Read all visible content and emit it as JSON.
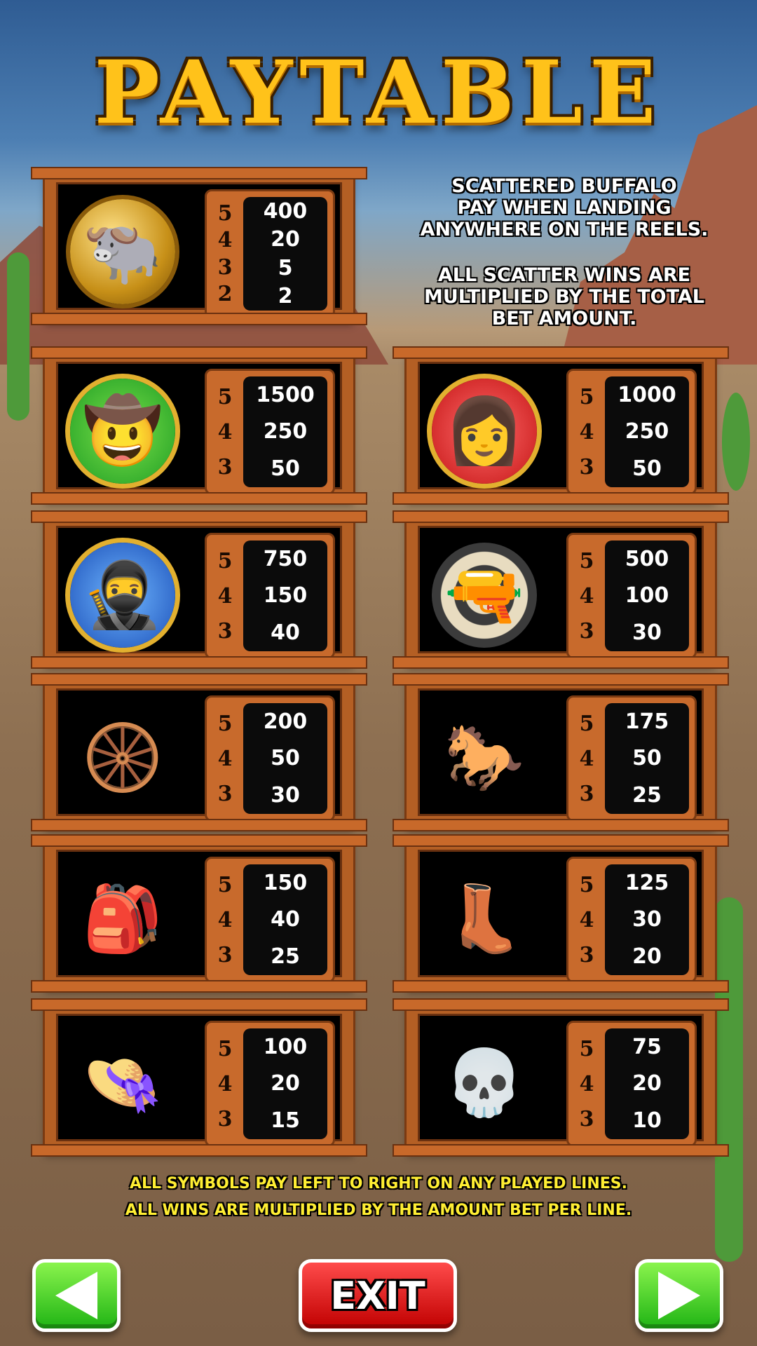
{
  "title": "PAYTABLE",
  "scatter_info": {
    "lines": [
      "SCATTERED BUFFALO",
      "PAY WHEN LANDING",
      "ANYWHERE ON THE REELS.",
      "",
      "ALL SCATTER WINS ARE",
      "MULTIPLIED BY THE TOTAL",
      "BET AMOUNT."
    ]
  },
  "symbols": [
    {
      "name": "buffalo",
      "icon": "buffalo-coin-icon",
      "glyph": "🐃",
      "counts": [
        "5",
        "4",
        "3",
        "2"
      ],
      "values": [
        "400",
        "20",
        "5",
        "2"
      ]
    },
    {
      "name": "cowboy",
      "icon": "cowboy-portrait-icon",
      "glyph": "🤠",
      "counts": [
        "5",
        "4",
        "3"
      ],
      "values": [
        "1500",
        "250",
        "50"
      ]
    },
    {
      "name": "cowgirl",
      "icon": "cowgirl-portrait-icon",
      "glyph": "👩",
      "counts": [
        "5",
        "4",
        "3"
      ],
      "values": [
        "1000",
        "250",
        "50"
      ]
    },
    {
      "name": "bandit",
      "icon": "bandit-portrait-icon",
      "glyph": "🥷",
      "counts": [
        "5",
        "4",
        "3"
      ],
      "values": [
        "750",
        "150",
        "40"
      ]
    },
    {
      "name": "revolver",
      "icon": "revolver-target-icon",
      "glyph": "🔫",
      "counts": [
        "5",
        "4",
        "3"
      ],
      "values": [
        "500",
        "100",
        "30"
      ]
    },
    {
      "name": "wagon",
      "icon": "covered-wagon-icon",
      "glyph": "🛞",
      "counts": [
        "5",
        "4",
        "3"
      ],
      "values": [
        "200",
        "50",
        "30"
      ]
    },
    {
      "name": "saddle",
      "icon": "saddle-icon",
      "glyph": "🐎",
      "counts": [
        "5",
        "4",
        "3"
      ],
      "values": [
        "175",
        "50",
        "25"
      ]
    },
    {
      "name": "gunbelt",
      "icon": "gun-belt-icon",
      "glyph": "🎒",
      "counts": [
        "5",
        "4",
        "3"
      ],
      "values": [
        "150",
        "40",
        "25"
      ]
    },
    {
      "name": "boots",
      "icon": "cowboy-boots-icon",
      "glyph": "👢",
      "counts": [
        "5",
        "4",
        "3"
      ],
      "values": [
        "125",
        "30",
        "20"
      ]
    },
    {
      "name": "hat",
      "icon": "cowboy-hat-icon",
      "glyph": "👒",
      "counts": [
        "5",
        "4",
        "3"
      ],
      "values": [
        "100",
        "20",
        "15"
      ]
    },
    {
      "name": "skull",
      "icon": "bull-skull-icon",
      "glyph": "💀",
      "counts": [
        "5",
        "4",
        "3"
      ],
      "values": [
        "75",
        "20",
        "10"
      ]
    }
  ],
  "rules": [
    "ALL SYMBOLS PAY LEFT TO RIGHT ON ANY PLAYED LINES.",
    "ALL WINS ARE MULTIPLIED BY THE AMOUNT BET PER LINE."
  ],
  "buttons": {
    "exit_label": "EXIT",
    "prev_icon": "left-arrow-icon",
    "next_icon": "right-arrow-icon"
  },
  "colors": {
    "title": "#ffc21a",
    "frame_wood": "#b45f24",
    "payout_bg": "#c86a2c",
    "rules_text": "#ffee33",
    "nav_green": "#1fb414",
    "exit_red": "#c00000"
  }
}
